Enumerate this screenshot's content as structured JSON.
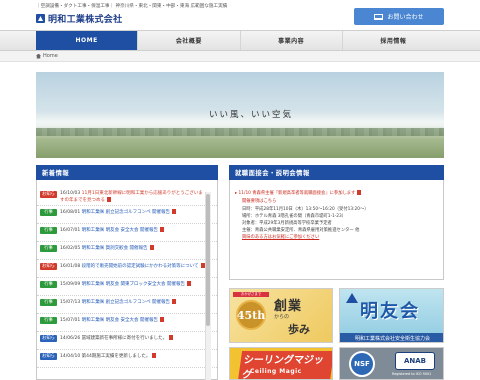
{
  "header": {
    "tagline": "｜空調設備・ダクト工事・保温工事｜ 神奈川県・東北・関東・中部・東海 広範囲な施工実績",
    "company_name": "明和工業株式会社",
    "contact_label": "お問い合わせ"
  },
  "nav": {
    "items": [
      {
        "label": "HOME",
        "active": true
      },
      {
        "label": "会社概要",
        "active": false
      },
      {
        "label": "事業内容",
        "active": false
      },
      {
        "label": "採用情報",
        "active": false
      }
    ]
  },
  "breadcrumb": {
    "home": "Home"
  },
  "hero": {
    "tagline": "いい風、いい空気"
  },
  "news": {
    "title": "新着情報",
    "items": [
      {
        "badge": "お知らせ",
        "color": "red",
        "date": "16/10/03",
        "text": "11月1日東北新幹線に明和工業から応援ありがとうございますの年までを見つめる",
        "link": true,
        "link_color": "red"
      },
      {
        "badge": "行事",
        "color": "green",
        "date": "16/08/01",
        "text": "明和工業㈱ 創立記念ゴルフコンペ 開催報告",
        "link": true,
        "link_color": "blue"
      },
      {
        "badge": "行事",
        "color": "green",
        "date": "16/07/01",
        "text": "明和工業㈱ 明友会 安全大会 開催報告",
        "link": true,
        "link_color": "blue"
      },
      {
        "badge": "行事",
        "color": "green",
        "date": "16/02/05",
        "text": "明和工業㈱ 賀詞交歓会 開催報告",
        "link": true,
        "link_color": "blue"
      },
      {
        "badge": "お知らせ",
        "color": "red",
        "date": "16/01/08",
        "text": "段階的で販売開始前の認定試験にかかわる対策等について",
        "link": true,
        "link_color": "blue"
      },
      {
        "badge": "行事",
        "color": "green",
        "date": "15/09/09",
        "text": "明和工業㈱ 明友会 関東ブロック安全大会 開催報告",
        "link": true,
        "link_color": "blue"
      },
      {
        "badge": "行事",
        "color": "green",
        "date": "15/07/13",
        "text": "明和工業㈱ 創立記念ゴルフコンペ 開催報告",
        "link": true,
        "link_color": "blue"
      },
      {
        "badge": "行事",
        "color": "green",
        "date": "15/07/01",
        "text": "明和工業㈱ 明友会 安全大会 開催報告",
        "link": true,
        "link_color": "blue"
      },
      {
        "badge": "お知らせ",
        "color": "blue",
        "date": "14/06/26",
        "text": "冨域建築新在事所様に寄付を行いました。",
        "link": false,
        "link_color": "blue"
      },
      {
        "badge": "お知らせ",
        "color": "blue",
        "date": "14/04/10",
        "text": "第44期施工実績を更新しました。",
        "link": false,
        "link_color": "blue"
      }
    ]
  },
  "job": {
    "title": "就職面接会・説明会情報",
    "event_title": "11/10 青森県主催『新規高卒者等就職面接会』に参加します",
    "detail_link": "開催要項はこちら",
    "date_line": "日時：平成28年11月10日（木）13:50〜16:20（受付13:20〜）",
    "venue_line": "場所：ホテル青森 3階孔雀の間（青森市堤町1-1-23）",
    "target_line": "対象者：平成29年3月新規高等学校卒業予定者",
    "organizer_line": "主催：青森公共職業安定所、青森県雇用対策推進センター 他",
    "footer_link": "興味のある方はお気軽にご参加ください"
  },
  "banners": {
    "anniv_ribbon": "おかげさまで",
    "anniv_number": "45th",
    "anniv_title": "創業",
    "anniv_sub": "からの",
    "anniv_walk": "歩み",
    "meiyu_title": "明友会",
    "meiyu_caption": "明和工業株式会社安全衛生協力会",
    "seal_title": "シーリングマジック",
    "seal_sub": "Ceiling Magic",
    "nsf_label": "NSF",
    "anab_label": "ANAB",
    "iso_label": "Registered to ISO 9001"
  }
}
